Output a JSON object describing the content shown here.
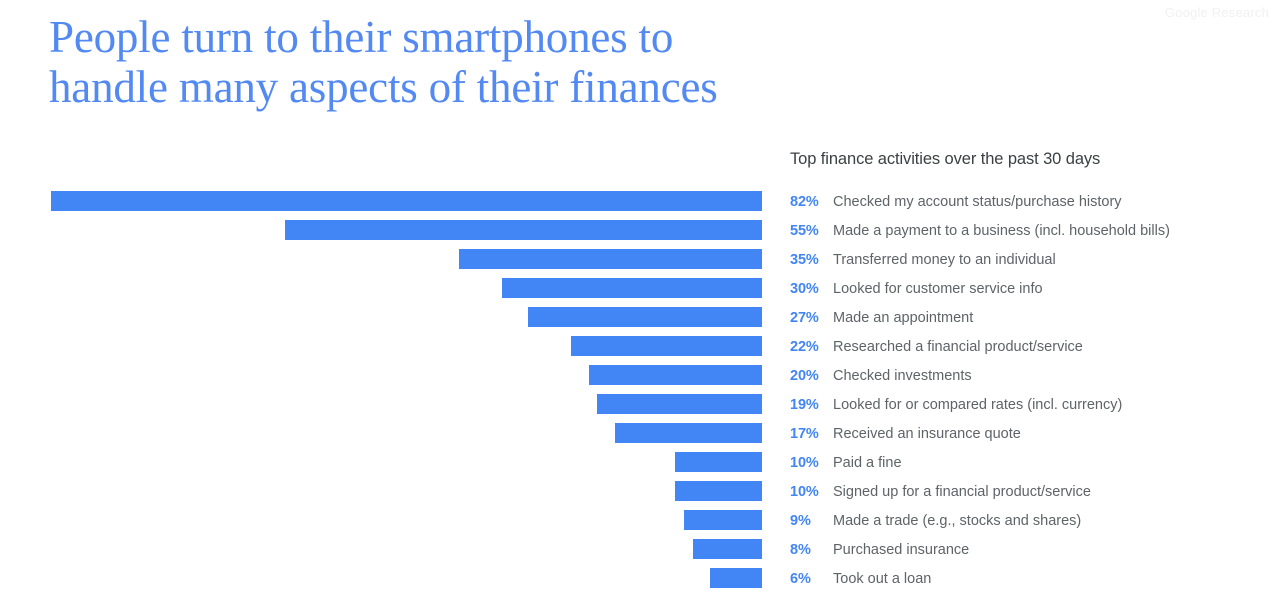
{
  "watermark": "Google Research",
  "title": {
    "line1": "People turn to their smartphones to",
    "line2": "handle many aspects of their finances"
  },
  "legend_heading": "Top finance activities over the past 30 days",
  "colors": {
    "bar": "#4285f4",
    "title": "#5289f2",
    "percent": "#4285f4",
    "label": "#5f6368",
    "heading": "#3c4043",
    "watermark": "#f1f1f1",
    "background": "#ffffff"
  },
  "chart_data": {
    "type": "bar",
    "orientation": "horizontal",
    "title": "People turn to their smartphones to handle many aspects of their finances",
    "subtitle": "Top finance activities over the past 30 days",
    "xlabel": "",
    "ylabel": "",
    "xlim": [
      0,
      82
    ],
    "grid": false,
    "legend": "right",
    "value_suffix": "%",
    "bars_right_aligned": true,
    "categories": [
      "Checked my account status/purchase history",
      "Made a payment to a business (incl. household bills)",
      "Transferred money to an individual",
      "Looked for customer service info",
      "Made an appointment",
      "Researched a financial product/service",
      "Checked investments",
      "Looked for or compared rates (incl. currency)",
      "Received an insurance quote",
      "Paid a fine",
      "Signed up for a financial product/service",
      "Made a trade (e.g., stocks and shares)",
      "Purchased insurance",
      "Took out a loan"
    ],
    "values": [
      82,
      55,
      35,
      30,
      27,
      22,
      20,
      19,
      17,
      10,
      10,
      9,
      8,
      6
    ],
    "value_labels": [
      "82%",
      "55%",
      "35%",
      "30%",
      "27%",
      "22%",
      "20%",
      "19%",
      "17%",
      "10%",
      "10%",
      "9%",
      "8%",
      "6%"
    ],
    "rows": [
      {
        "pct": "82%",
        "value": 82,
        "label": "Checked my account status/purchase history"
      },
      {
        "pct": "55%",
        "value": 55,
        "label": "Made a payment to a business (incl. household bills)"
      },
      {
        "pct": "35%",
        "value": 35,
        "label": "Transferred money to an individual"
      },
      {
        "pct": "30%",
        "value": 30,
        "label": "Looked for customer service info"
      },
      {
        "pct": "27%",
        "value": 27,
        "label": "Made an appointment"
      },
      {
        "pct": "22%",
        "value": 22,
        "label": "Researched a financial product/service"
      },
      {
        "pct": "20%",
        "value": 20,
        "label": "Checked investments"
      },
      {
        "pct": "19%",
        "value": 19,
        "label": "Looked for or compared rates (incl. currency)"
      },
      {
        "pct": "17%",
        "value": 17,
        "label": "Received an insurance quote"
      },
      {
        "pct": "10%",
        "value": 10,
        "label": "Paid a fine"
      },
      {
        "pct": "10%",
        "value": 10,
        "label": "Signed up for a financial product/service"
      },
      {
        "pct": "9%",
        "value": 9,
        "label": "Made a trade (e.g., stocks and shares)"
      },
      {
        "pct": "8%",
        "value": 8,
        "label": "Purchased insurance"
      },
      {
        "pct": "6%",
        "value": 6,
        "label": "Took out a loan"
      }
    ]
  }
}
